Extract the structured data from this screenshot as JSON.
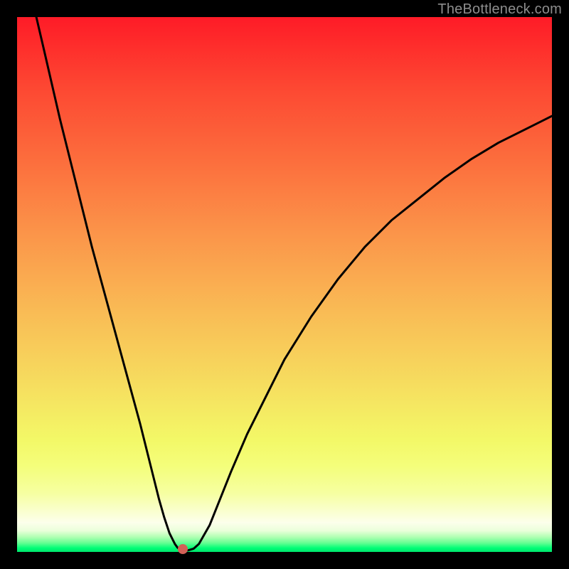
{
  "watermark": "TheBottleneck.com",
  "colors": {
    "frame": "#000000",
    "curve": "#000000",
    "dot": "#d36157",
    "watermark": "#8d8d8d"
  },
  "chart_data": {
    "type": "line",
    "title": "",
    "xlabel": "",
    "ylabel": "",
    "xlim": [
      0,
      100
    ],
    "ylim": [
      0,
      100
    ],
    "grid": false,
    "legend": false,
    "curve": {
      "x": [
        3.6,
        5,
        8,
        11,
        14,
        17,
        20,
        23,
        25,
        26.5,
        27.5,
        28.5,
        29.5,
        30,
        30.5,
        31,
        32,
        33,
        34,
        36,
        38,
        40,
        43,
        46,
        50,
        55,
        60,
        65,
        70,
        75,
        80,
        85,
        90,
        95,
        100
      ],
      "y": [
        100,
        94,
        81,
        69,
        57,
        46,
        35,
        24,
        16,
        10,
        6.5,
        3.5,
        1.5,
        0.8,
        0.4,
        0.3,
        0.3,
        0.6,
        1.5,
        5,
        10,
        15,
        22,
        28,
        36,
        44,
        51,
        57,
        62,
        66,
        70,
        73.5,
        76.5,
        79,
        81.5
      ]
    },
    "marker": {
      "x": 31,
      "y": 0.5
    }
  }
}
